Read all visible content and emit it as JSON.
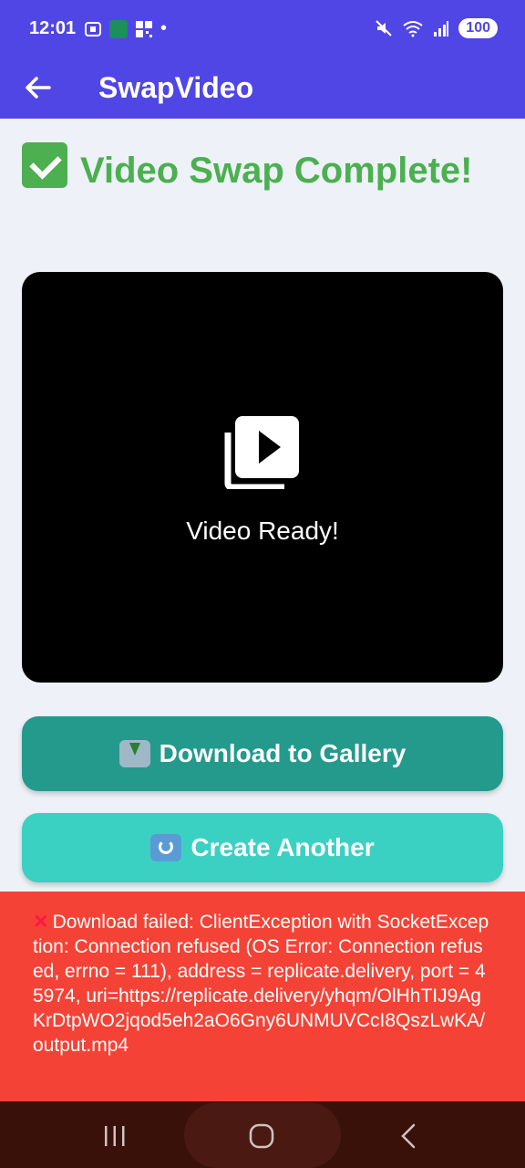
{
  "status_bar": {
    "time": "12:01",
    "dot": "•",
    "battery": "100",
    "icons": [
      "screenshot-icon",
      "app-icon",
      "qr-icon",
      "mute-icon",
      "wifi-icon",
      "signal-icon"
    ]
  },
  "app_bar": {
    "title": "SwapVideo",
    "back_icon": "arrow-left-icon",
    "color": "#5046e5"
  },
  "main": {
    "headline": "Video Swap Complete!",
    "headline_color": "#4caf50",
    "video_card": {
      "icon": "video-library-icon",
      "label": "Video Ready!"
    },
    "download_button": {
      "label": "Download to Gallery",
      "icon": "inbox-tray-icon",
      "color": "#239a8c"
    },
    "create_button": {
      "label": "Create Another",
      "icon": "refresh-icon",
      "color": "#3ad1c3"
    }
  },
  "error_banner": {
    "icon": "cross-mark-icon",
    "message": "Download failed: ClientException with SocketException: Connection refused (OS Error: Connection refused, errno = 111), address = replicate.delivery, port = 45974, uri=https://replicate.delivery/yhqm/OlHhTIJ9AgKrDtpWO2jqod5eh2aO6Gny6UNMUVCcI8QszLwKA/output.mp4",
    "color": "#f44336"
  },
  "nav_bar": {
    "recent_icon": "recent-apps-icon",
    "home_icon": "home-icon",
    "back_icon": "back-icon"
  }
}
